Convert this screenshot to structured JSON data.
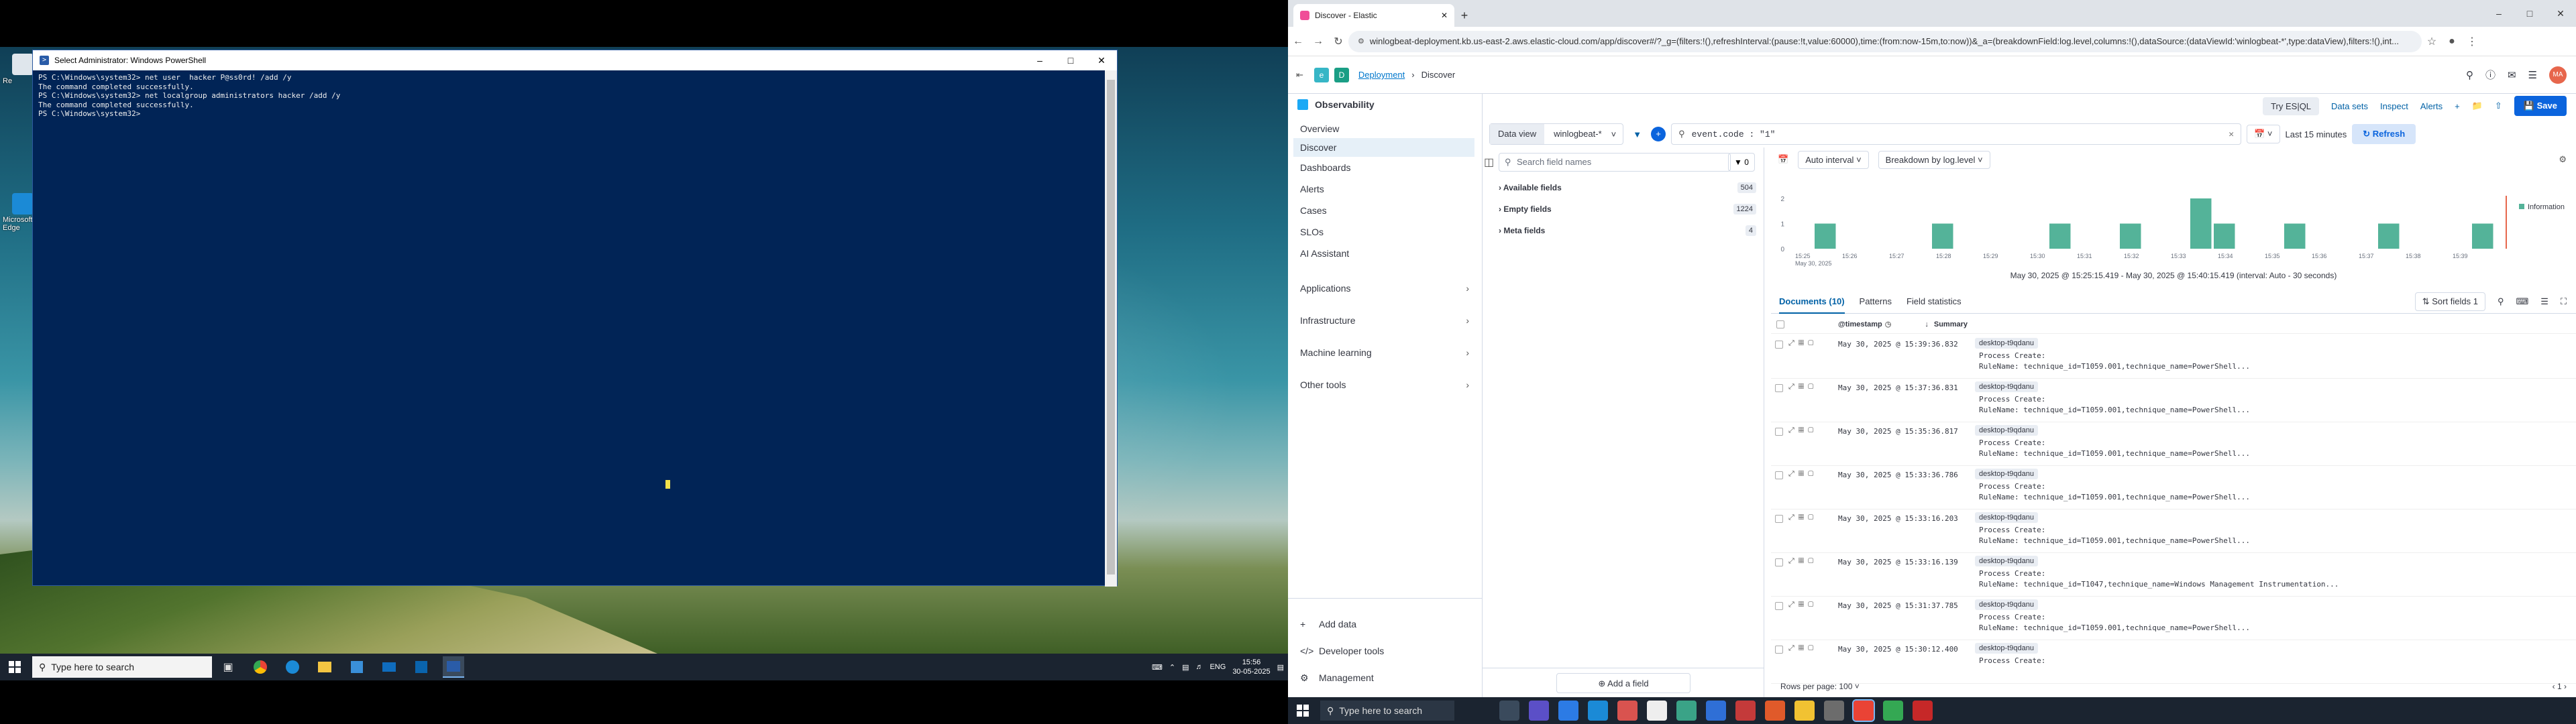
{
  "powershell": {
    "title": "Select Administrator: Windows PowerShell",
    "lines": [
      "PS C:\\Windows\\system32> net user  hacker P@ss0rd! /add /y",
      "The command completed successfully.",
      "",
      "PS C:\\Windows\\system32> net localgroup administrators hacker /add /y",
      "The command completed successfully.",
      "",
      "PS C:\\Windows\\system32>"
    ]
  },
  "desktop": {
    "icons": [
      "Re",
      "Microsoft Edge"
    ]
  },
  "taskbar_left": {
    "search_placeholder": "Type here to search",
    "lang": "ENG",
    "time": "15:56",
    "date": "30-05-2025"
  },
  "browser": {
    "tab_title": "Discover - Elastic",
    "url": "winlogbeat-deployment.kb.us-east-2.aws.elastic-cloud.com/app/discover#/?_g=(filters:!(),refreshInterval:(pause:!t,value:60000),time:(from:now-15m,to:now))&_a=(breakdownField:log.level,columns:!(),dataSource:(dataViewId:'winlogbeat-*',type:dataView),filters:!(),int..."
  },
  "kibana": {
    "crumb_deployment": "Deployment",
    "crumb_page": "Discover",
    "avatar": "MA"
  },
  "nav": {
    "title": "Observability",
    "items": [
      "Overview",
      "Discover",
      "Dashboards",
      "Alerts",
      "Cases",
      "SLOs",
      "AI Assistant"
    ],
    "groups": [
      "Applications",
      "Infrastructure",
      "Machine learning",
      "Other tools"
    ],
    "bottom": [
      "Add data",
      "Developer tools",
      "Management"
    ]
  },
  "actions": {
    "try_esql": "Try ES|QL",
    "data_sets": "Data sets",
    "inspect": "Inspect",
    "alerts": "Alerts",
    "save": "Save"
  },
  "query": {
    "data_view_label": "Data view",
    "data_view": "winlogbeat-*",
    "text": "event.code : \"1\"",
    "time": "Last 15 minutes",
    "refresh": "Refresh"
  },
  "fields": {
    "search_placeholder": "Search field names",
    "filter_count": "0",
    "available_label": "Available fields",
    "available_count": "504",
    "empty_label": "Empty fields",
    "empty_count": "1224",
    "meta_label": "Meta fields",
    "meta_count": "4",
    "add_field": "Add a field"
  },
  "histogram": {
    "interval": "Auto interval",
    "breakdown": "Breakdown by log.level",
    "legend": "Information",
    "range": "May 30, 2025 @ 15:25:15.419 - May 30, 2025 @ 15:40:15.419 (interval: Auto - 30 seconds)"
  },
  "tabs": {
    "documents": "Documents (10)",
    "patterns": "Patterns",
    "field_stats": "Field statistics",
    "sort_fields": "Sort fields",
    "sort_count": "1"
  },
  "grid": {
    "col_timestamp": "@timestamp",
    "col_summary": "Summary",
    "rows_per_page": "Rows per page: 100",
    "rows": [
      {
        "ts": "May 30, 2025 @ 15:39:36.832",
        "host": "desktop-t9qdanu",
        "l1": "Process Create:",
        "l2": "RuleName: technique_id=T1059.001,technique_name=PowerShell..."
      },
      {
        "ts": "May 30, 2025 @ 15:37:36.831",
        "host": "desktop-t9qdanu",
        "l1": "Process Create:",
        "l2": "RuleName: technique_id=T1059.001,technique_name=PowerShell..."
      },
      {
        "ts": "May 30, 2025 @ 15:35:36.817",
        "host": "desktop-t9qdanu",
        "l1": "Process Create:",
        "l2": "RuleName: technique_id=T1059.001,technique_name=PowerShell..."
      },
      {
        "ts": "May 30, 2025 @ 15:33:36.786",
        "host": "desktop-t9qdanu",
        "l1": "Process Create:",
        "l2": "RuleName: technique_id=T1059.001,technique_name=PowerShell..."
      },
      {
        "ts": "May 30, 2025 @ 15:33:16.203",
        "host": "desktop-t9qdanu",
        "l1": "Process Create:",
        "l2": "RuleName: technique_id=T1059.001,technique_name=PowerShell..."
      },
      {
        "ts": "May 30, 2025 @ 15:33:16.139",
        "host": "desktop-t9qdanu",
        "l1": "Process Create:",
        "l2": "RuleName: technique_id=T1047,technique_name=Windows Management Instrumentation..."
      },
      {
        "ts": "May 30, 2025 @ 15:31:37.785",
        "host": "desktop-t9qdanu",
        "l1": "Process Create:",
        "l2": "RuleName: technique_id=T1059.001,technique_name=PowerShell..."
      },
      {
        "ts": "May 30, 2025 @ 15:30:12.400",
        "host": "desktop-t9qdanu",
        "l1": "Process Create:",
        "l2": ""
      }
    ]
  },
  "taskbar_right": {
    "search_placeholder": "Type here to search"
  },
  "chart_data": {
    "type": "bar",
    "x_ticks": [
      "15:25\nMay 30, 2025",
      "15:26",
      "15:27",
      "15:28",
      "15:29",
      "15:30",
      "15:31",
      "15:32",
      "15:33",
      "15:34",
      "15:35",
      "15:36",
      "15:37",
      "15:38",
      "15:39"
    ],
    "y_ticks": [
      0,
      1,
      2
    ],
    "ylim": [
      0,
      2
    ],
    "series": [
      {
        "name": "Information",
        "color": "#54b399",
        "points": [
          [
            0.5,
            1
          ],
          [
            3,
            1
          ],
          [
            5.5,
            1
          ],
          [
            7,
            1
          ],
          [
            8.5,
            2
          ],
          [
            9,
            1
          ],
          [
            10.5,
            1
          ],
          [
            12.5,
            1
          ],
          [
            14.5,
            1
          ]
        ]
      }
    ]
  }
}
